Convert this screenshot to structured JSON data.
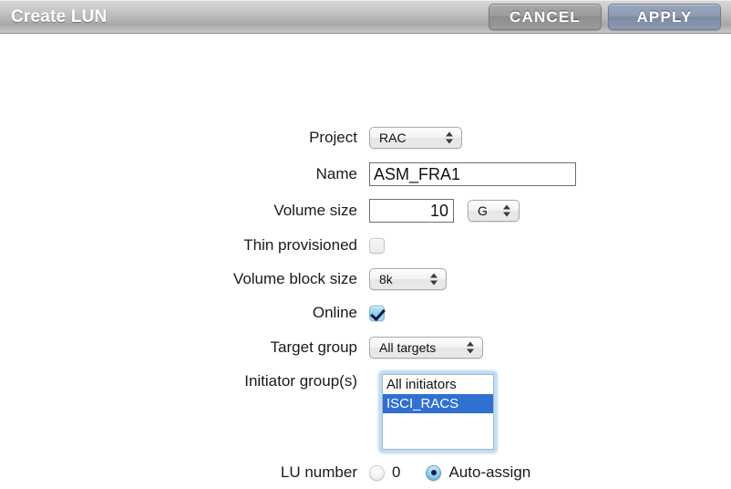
{
  "window": {
    "title": "Create LUN",
    "cancel_label": "CANCEL",
    "apply_label": "APPLY"
  },
  "colors": {
    "apply_button": "#8e9bb2",
    "cancel_button": "#9d9d9d",
    "selection_blue": "#2f70d0",
    "focus_ring": "#c3dcf3",
    "checkbox_checked": "#8fcdef"
  },
  "form": {
    "project": {
      "label": "Project",
      "value": "RAC"
    },
    "name": {
      "label": "Name",
      "value": "ASM_FRA1"
    },
    "volume_size": {
      "label": "Volume size",
      "value": "10",
      "unit": "G"
    },
    "thin_provisioned": {
      "label": "Thin provisioned",
      "checked": false
    },
    "volume_block_size": {
      "label": "Volume block size",
      "value": "8k"
    },
    "online": {
      "label": "Online",
      "checked": true
    },
    "target_group": {
      "label": "Target group",
      "value": "All targets"
    },
    "initiator_groups": {
      "label": "Initiator group(s)",
      "options": [
        {
          "text": "All initiators",
          "selected": false
        },
        {
          "text": "ISCI_RACS",
          "selected": true
        }
      ]
    },
    "lu_number": {
      "label": "LU number",
      "options": [
        {
          "text": "0",
          "selected": false
        },
        {
          "text": "Auto-assign",
          "selected": true
        }
      ]
    }
  }
}
